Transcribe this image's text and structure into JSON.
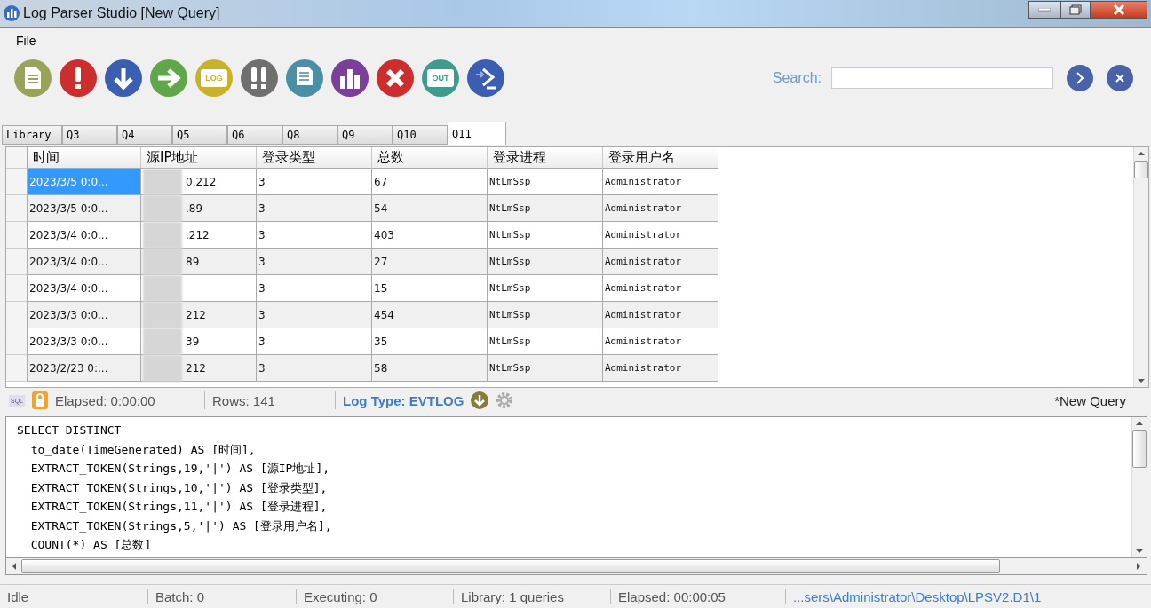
{
  "window": {
    "title": "Log Parser Studio  [New Query]"
  },
  "menu": [
    "File"
  ],
  "toolbar": [
    {
      "kind": "new"
    },
    {
      "kind": "run"
    },
    {
      "kind": "download"
    },
    {
      "kind": "go"
    },
    {
      "kind": "log",
      "label": "LOG"
    },
    {
      "kind": "runall"
    },
    {
      "kind": "doc"
    },
    {
      "kind": "chart"
    },
    {
      "kind": "stop"
    },
    {
      "kind": "out",
      "label": "OUT"
    },
    {
      "kind": "shell"
    }
  ],
  "search": {
    "label": "Search:"
  },
  "tabs": [
    {
      "label": "Library",
      "selected": false
    },
    {
      "label": "Q3",
      "selected": false
    },
    {
      "label": "Q4",
      "selected": false
    },
    {
      "label": "Q5",
      "selected": false
    },
    {
      "label": "Q6",
      "selected": false
    },
    {
      "label": "Q8",
      "selected": false
    },
    {
      "label": "Q9",
      "selected": false
    },
    {
      "label": "Q10",
      "selected": false
    },
    {
      "label": "Q11",
      "selected": true
    }
  ],
  "table": {
    "columns": [
      "时间",
      "源IP地址",
      "登录类型",
      "总数",
      "登录进程",
      "登录用户名"
    ],
    "rows": [
      {
        "selected": true,
        "cells": [
          "2023/3/5 0:0...",
          "0.212",
          "3",
          "67",
          "NtLmSsp",
          "Administrator"
        ]
      },
      {
        "selected": false,
        "cells": [
          "2023/3/5 0:0...",
          ".89",
          "3",
          "54",
          "NtLmSsp",
          "Administrator"
        ]
      },
      {
        "selected": false,
        "cells": [
          "2023/3/4 0:0...",
          ".212",
          "3",
          "403",
          "NtLmSsp",
          "Administrator"
        ]
      },
      {
        "selected": false,
        "cells": [
          "2023/3/4 0:0...",
          "89",
          "3",
          "27",
          "NtLmSsp",
          "Administrator"
        ]
      },
      {
        "selected": false,
        "cells": [
          "2023/3/4 0:0...",
          null,
          "3",
          "15",
          "NtLmSsp",
          "Administrator"
        ]
      },
      {
        "selected": false,
        "cells": [
          "2023/3/3 0:0...",
          "212",
          "3",
          "454",
          "NtLmSsp",
          "Administrator"
        ]
      },
      {
        "selected": false,
        "cells": [
          "2023/3/3 0:0...",
          "39",
          "3",
          "35",
          "NtLmSsp",
          "Administrator"
        ]
      },
      {
        "selected": false,
        "cells": [
          "2023/2/23 0:...",
          "212",
          "3",
          "58",
          "NtLmSsp",
          "Administrator"
        ]
      }
    ]
  },
  "query_bar": {
    "sql_badge": "SQL",
    "elapsed": "Elapsed: 0:00:00",
    "rows": "Rows: 141",
    "log_type": "Log Type: EVTLOG",
    "query_name": "*New Query"
  },
  "editor": {
    "lines": [
      "SELECT DISTINCT",
      "  to_date(TimeGenerated) AS [时间],",
      "  EXTRACT_TOKEN(Strings,19,'|') AS [源IP地址],",
      "  EXTRACT_TOKEN(Strings,10,'|') AS [登录类型],",
      "  EXTRACT_TOKEN(Strings,11,'|') AS [登录进程],",
      "  EXTRACT_TOKEN(Strings,5,'|') AS [登录用户名],",
      "  COUNT(*) AS [总数]"
    ]
  },
  "status_bar": [
    "Idle",
    "Batch: 0",
    "Executing: 0",
    "Library: 1 queries",
    "Elapsed: 00:00:05",
    "...sers\\Administrator\\Desktop\\LPSV2.D1\\1"
  ]
}
